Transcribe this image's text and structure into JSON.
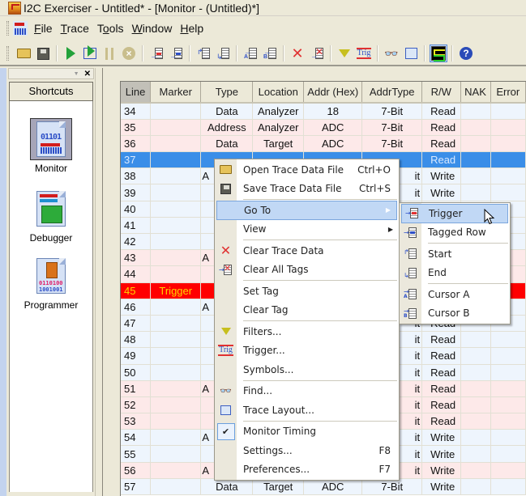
{
  "window": {
    "title": "I2C Exerciser - Untitled* - [Monitor - (Untitled)*]"
  },
  "menubar": {
    "items": [
      {
        "label": "File",
        "accel": "F"
      },
      {
        "label": "Trace",
        "accel": "T"
      },
      {
        "label": "Tools",
        "accel": "o"
      },
      {
        "label": "Window",
        "accel": "W"
      },
      {
        "label": "Help",
        "accel": "H"
      }
    ]
  },
  "toolbar": {
    "buttons": [
      {
        "name": "open-icon",
        "tooltip": "Open"
      },
      {
        "name": "save-icon",
        "tooltip": "Save"
      },
      {
        "name": "run-icon",
        "tooltip": "Run"
      },
      {
        "name": "run-step-icon",
        "tooltip": "Run Step"
      },
      {
        "name": "pause-icon",
        "tooltip": "Pause"
      },
      {
        "name": "stop-icon",
        "tooltip": "Stop"
      },
      {
        "name": "goto-trigger-icon",
        "tooltip": "Go To Trigger"
      },
      {
        "name": "goto-tagged-row-icon",
        "tooltip": "Go To Tagged Row"
      },
      {
        "name": "goto-start-icon",
        "tooltip": "Go To Start"
      },
      {
        "name": "goto-end-icon",
        "tooltip": "Go To End"
      },
      {
        "name": "goto-cursor-a-icon",
        "tooltip": "Go To Cursor A"
      },
      {
        "name": "goto-cursor-b-icon",
        "tooltip": "Go To Cursor B"
      },
      {
        "name": "clear-trace-icon",
        "tooltip": "Clear Trace Data"
      },
      {
        "name": "clear-tags-icon",
        "tooltip": "Clear All Tags"
      },
      {
        "name": "filter-icon",
        "tooltip": "Filters"
      },
      {
        "name": "trigger-icon",
        "tooltip": "Trigger",
        "text": "Trig"
      },
      {
        "name": "find-icon",
        "tooltip": "Find"
      },
      {
        "name": "trace-layout-icon",
        "tooltip": "Trace Layout"
      },
      {
        "name": "monitor-timing-icon",
        "tooltip": "Monitor Timing",
        "active": true
      },
      {
        "name": "help-icon",
        "tooltip": "Help",
        "text": "?"
      }
    ]
  },
  "shortcuts": {
    "title": "Shortcuts",
    "items": [
      {
        "label": "Monitor",
        "icon": "monitor-icon",
        "icon_text": "01101",
        "selected": true
      },
      {
        "label": "Debugger",
        "icon": "debugger-icon",
        "selected": false
      },
      {
        "label": "Programmer",
        "icon": "programmer-icon",
        "icon_text_1": "0110100",
        "icon_text_2": "1001001",
        "selected": false
      }
    ]
  },
  "trace_table": {
    "columns": [
      "Line",
      "Marker",
      "Type",
      "Location",
      "Addr (Hex)",
      "AddrType",
      "R/W",
      "NAK",
      "Error"
    ],
    "sorted_column": "Line",
    "rows": [
      {
        "line": "34",
        "marker": "",
        "type": "Data",
        "location": "Analyzer",
        "addr": "18",
        "addrtype": "7-Bit",
        "rw": "Read",
        "nak": "",
        "error": "",
        "color": "blue"
      },
      {
        "line": "35",
        "marker": "",
        "type": "Address",
        "location": "Analyzer",
        "addr": "ADC",
        "addrtype": "7-Bit",
        "rw": "Read",
        "nak": "",
        "error": "",
        "color": "pink"
      },
      {
        "line": "36",
        "marker": "",
        "type": "Data",
        "location": "Target",
        "addr": "ADC",
        "addrtype": "7-Bit",
        "rw": "Read",
        "nak": "",
        "error": "",
        "color": "pink"
      },
      {
        "line": "37",
        "marker": "",
        "type": "",
        "location": "",
        "addr": "",
        "addrtype": "",
        "rw": "Read",
        "nak": "",
        "error": "",
        "color": "selected"
      },
      {
        "line": "38",
        "marker": "",
        "type": "A",
        "location": "",
        "addr": "",
        "addrtype": "it",
        "rw": "Write",
        "nak": "",
        "error": "",
        "color": "blue"
      },
      {
        "line": "39",
        "marker": "",
        "type": "",
        "location": "",
        "addr": "",
        "addrtype": "it",
        "rw": "Write",
        "nak": "",
        "error": "",
        "color": "blue"
      },
      {
        "line": "40",
        "marker": "",
        "type": "",
        "location": "",
        "addr": "",
        "addrtype": "",
        "rw": "",
        "nak": "",
        "error": "",
        "color": "blue"
      },
      {
        "line": "41",
        "marker": "",
        "type": "",
        "location": "",
        "addr": "",
        "addrtype": "",
        "rw": "",
        "nak": "",
        "error": "",
        "color": "blue"
      },
      {
        "line": "42",
        "marker": "",
        "type": "",
        "location": "",
        "addr": "",
        "addrtype": "",
        "rw": "",
        "nak": "",
        "error": "",
        "color": "blue"
      },
      {
        "line": "43",
        "marker": "",
        "type": "A",
        "location": "",
        "addr": "",
        "addrtype": "",
        "rw": "",
        "nak": "",
        "error": "",
        "color": "pink"
      },
      {
        "line": "44",
        "marker": "",
        "type": "",
        "location": "",
        "addr": "",
        "addrtype": "",
        "rw": "",
        "nak": "",
        "error": "",
        "color": "pink"
      },
      {
        "line": "45",
        "marker": "Trigger",
        "type": "",
        "location": "",
        "addr": "",
        "addrtype": "",
        "rw": "",
        "nak": "",
        "error": "",
        "color": "trigger"
      },
      {
        "line": "46",
        "marker": "",
        "type": "A",
        "location": "",
        "addr": "",
        "addrtype": "",
        "rw": "",
        "nak": "",
        "error": "",
        "color": "blue"
      },
      {
        "line": "47",
        "marker": "",
        "type": "",
        "location": "",
        "addr": "",
        "addrtype": "it",
        "rw": "Read",
        "nak": "",
        "error": "",
        "color": "blue"
      },
      {
        "line": "48",
        "marker": "",
        "type": "",
        "location": "",
        "addr": "",
        "addrtype": "it",
        "rw": "Read",
        "nak": "",
        "error": "",
        "color": "blue"
      },
      {
        "line": "49",
        "marker": "",
        "type": "",
        "location": "",
        "addr": "",
        "addrtype": "it",
        "rw": "Read",
        "nak": "",
        "error": "",
        "color": "blue"
      },
      {
        "line": "50",
        "marker": "",
        "type": "",
        "location": "",
        "addr": "",
        "addrtype": "it",
        "rw": "Read",
        "nak": "",
        "error": "",
        "color": "blue"
      },
      {
        "line": "51",
        "marker": "",
        "type": "A",
        "location": "",
        "addr": "",
        "addrtype": "it",
        "rw": "Read",
        "nak": "",
        "error": "",
        "color": "pink"
      },
      {
        "line": "52",
        "marker": "",
        "type": "",
        "location": "",
        "addr": "",
        "addrtype": "it",
        "rw": "Read",
        "nak": "",
        "error": "",
        "color": "pink"
      },
      {
        "line": "53",
        "marker": "",
        "type": "",
        "location": "",
        "addr": "",
        "addrtype": "it",
        "rw": "Read",
        "nak": "",
        "error": "",
        "color": "pink"
      },
      {
        "line": "54",
        "marker": "",
        "type": "A",
        "location": "",
        "addr": "",
        "addrtype": "it",
        "rw": "Write",
        "nak": "",
        "error": "",
        "color": "blue"
      },
      {
        "line": "55",
        "marker": "",
        "type": "",
        "location": "",
        "addr": "",
        "addrtype": "it",
        "rw": "Write",
        "nak": "",
        "error": "",
        "color": "blue"
      },
      {
        "line": "56",
        "marker": "",
        "type": "A",
        "location": "",
        "addr": "",
        "addrtype": "it",
        "rw": "Write",
        "nak": "",
        "error": "",
        "color": "pink"
      },
      {
        "line": "57",
        "marker": "",
        "type": "Data",
        "location": "Target",
        "addr": "ADC",
        "addrtype": "7-Bit",
        "rw": "Write",
        "nak": "",
        "error": "",
        "color": "blue"
      }
    ]
  },
  "context_menu": {
    "items": [
      {
        "label": "Open Trace Data File",
        "shortcut": "Ctrl+O",
        "icon": "open-folder-icon"
      },
      {
        "label": "Save Trace Data File",
        "shortcut": "Ctrl+S",
        "icon": "save-icon"
      },
      {
        "separator": true
      },
      {
        "label": "Go To",
        "submenu": true,
        "highlighted": true
      },
      {
        "label": "View",
        "submenu": true
      },
      {
        "separator": true
      },
      {
        "label": "Clear Trace Data",
        "icon": "clear-trace-icon"
      },
      {
        "label": "Clear All Tags",
        "icon": "clear-tags-icon"
      },
      {
        "separator": true
      },
      {
        "label": "Set Tag"
      },
      {
        "label": "Clear Tag"
      },
      {
        "separator": true
      },
      {
        "label": "Filters...",
        "icon": "filter-icon"
      },
      {
        "label": "Trigger...",
        "icon": "trigger-icon",
        "icon_text": "Trig"
      },
      {
        "label": "Symbols..."
      },
      {
        "separator": true
      },
      {
        "label": "Find...",
        "icon": "find-icon"
      },
      {
        "label": "Trace Layout...",
        "icon": "trace-layout-icon"
      },
      {
        "separator": true
      },
      {
        "label": "Monitor Timing",
        "checked": true
      },
      {
        "label": "Settings...",
        "shortcut": "F8"
      },
      {
        "label": "Preferences...",
        "shortcut": "F7"
      }
    ]
  },
  "goto_submenu": {
    "items": [
      {
        "label": "Trigger",
        "icon": "goto-trigger-icon",
        "highlighted": true
      },
      {
        "label": "Tagged Row",
        "icon": "goto-tagged-row-icon"
      },
      {
        "separator": true
      },
      {
        "label": "Start",
        "icon": "goto-start-icon"
      },
      {
        "label": "End",
        "icon": "goto-end-icon"
      },
      {
        "separator": true
      },
      {
        "label": "Cursor A",
        "icon": "goto-cursor-a-icon",
        "icon_letter": "A"
      },
      {
        "label": "Cursor B",
        "icon": "goto-cursor-b-icon",
        "icon_letter": "B"
      }
    ]
  },
  "colors": {
    "row_blue": "#eef5fd",
    "row_pink": "#fde9e9",
    "row_selected": "#3a8ee8",
    "row_trigger": "#ff0000",
    "trigger_text": "#ffd400",
    "menu_highlight": "#c1d8f5"
  }
}
